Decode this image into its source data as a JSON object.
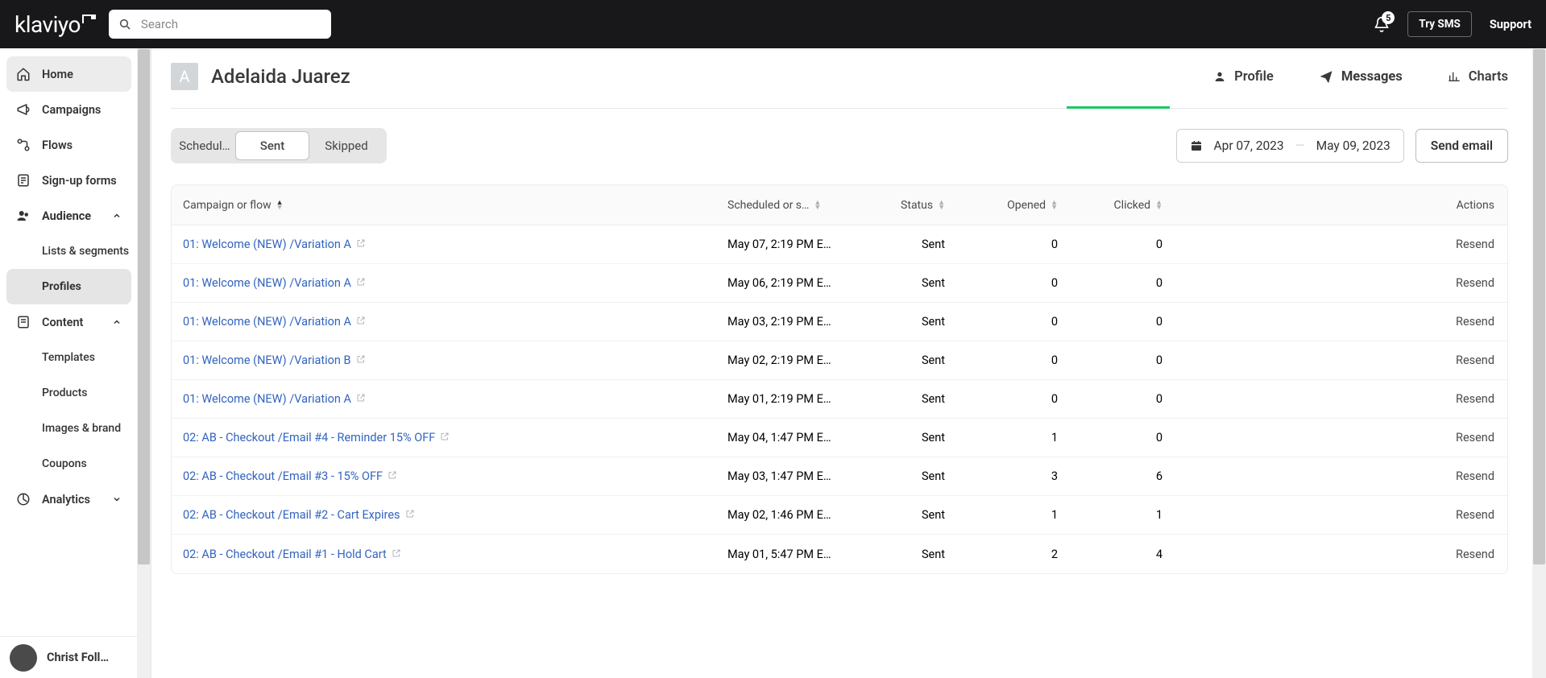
{
  "topbar": {
    "logo": "klaviyo",
    "search_placeholder": "Search",
    "notif_count": "5",
    "try_sms": "Try SMS",
    "support": "Support"
  },
  "sidebar": {
    "items": [
      {
        "label": "Home"
      },
      {
        "label": "Campaigns"
      },
      {
        "label": "Flows"
      },
      {
        "label": "Sign-up forms"
      },
      {
        "label": "Audience"
      },
      {
        "label": "Content"
      },
      {
        "label": "Analytics"
      }
    ],
    "audience_sub": [
      {
        "label": "Lists & segments"
      },
      {
        "label": "Profiles"
      }
    ],
    "content_sub": [
      {
        "label": "Templates"
      },
      {
        "label": "Products"
      },
      {
        "label": "Images & brand"
      },
      {
        "label": "Coupons"
      }
    ],
    "user": "Christ Foll…"
  },
  "profile": {
    "initial": "A",
    "name": "Adelaida Juarez",
    "tabs": {
      "profile": "Profile",
      "messages": "Messages",
      "charts": "Charts"
    }
  },
  "controls": {
    "segs": {
      "scheduled": "Schedul…",
      "sent": "Sent",
      "skipped": "Skipped"
    },
    "date_from": "Apr 07, 2023",
    "date_to": "May 09, 2023",
    "send_email": "Send email"
  },
  "table": {
    "headers": {
      "name": "Campaign or flow",
      "sched": "Scheduled or s…",
      "status": "Status",
      "opened": "Opened",
      "clicked": "Clicked",
      "actions": "Actions"
    },
    "resend_label": "Resend",
    "rows": [
      {
        "name": "01: Welcome (NEW) /Variation A",
        "sched": "May 07, 2:19 PM E…",
        "status": "Sent",
        "opened": "0",
        "clicked": "0"
      },
      {
        "name": "01: Welcome (NEW) /Variation A",
        "sched": "May 06, 2:19 PM E…",
        "status": "Sent",
        "opened": "0",
        "clicked": "0"
      },
      {
        "name": "01: Welcome (NEW) /Variation A",
        "sched": "May 03, 2:19 PM E…",
        "status": "Sent",
        "opened": "0",
        "clicked": "0"
      },
      {
        "name": "01: Welcome (NEW) /Variation B",
        "sched": "May 02, 2:19 PM E…",
        "status": "Sent",
        "opened": "0",
        "clicked": "0"
      },
      {
        "name": "01: Welcome (NEW) /Variation A",
        "sched": "May 01, 2:19 PM E…",
        "status": "Sent",
        "opened": "0",
        "clicked": "0"
      },
      {
        "name": "02: AB - Checkout /Email #4 - Reminder 15% OFF",
        "sched": "May 04, 1:47 PM E…",
        "status": "Sent",
        "opened": "1",
        "clicked": "0"
      },
      {
        "name": "02: AB - Checkout /Email #3 - 15% OFF",
        "sched": "May 03, 1:47 PM E…",
        "status": "Sent",
        "opened": "3",
        "clicked": "6"
      },
      {
        "name": "02: AB - Checkout /Email #2 - Cart Expires",
        "sched": "May 02, 1:46 PM E…",
        "status": "Sent",
        "opened": "1",
        "clicked": "1"
      },
      {
        "name": "02: AB - Checkout /Email #1 - Hold Cart",
        "sched": "May 01, 5:47 PM E…",
        "status": "Sent",
        "opened": "2",
        "clicked": "4"
      }
    ]
  }
}
